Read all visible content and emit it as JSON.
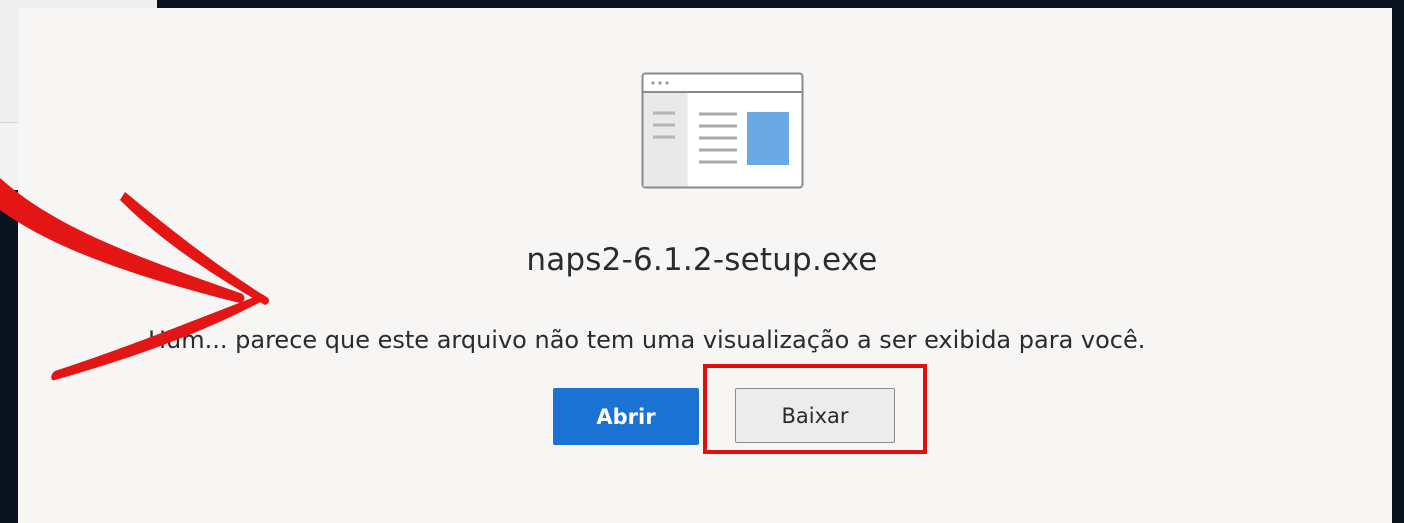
{
  "preview": {
    "file_name": "naps2-6.1.2-setup.exe",
    "message": "Hum... parece que este arquivo não tem uma visualização a ser exibida para você.",
    "icon": "document-window-icon"
  },
  "actions": {
    "open_label": "Abrir",
    "download_label": "Baixar"
  },
  "annotation": {
    "arrow": "red-arrow-icon",
    "highlight_color": "#e01010"
  },
  "colors": {
    "primary": "#1a73d2",
    "panel_bg": "#f7f6f5",
    "page_bg": "#0b1220"
  }
}
